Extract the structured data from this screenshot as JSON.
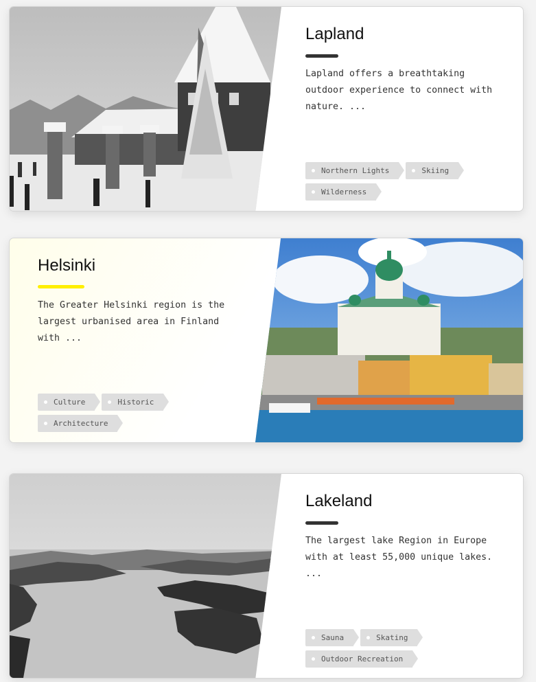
{
  "cards": [
    {
      "title": "Lapland",
      "description": "Lapland offers a breathtaking outdoor experience to connect with nature. ...",
      "tags": [
        "Northern Lights",
        "Skiing",
        "Wilderness"
      ],
      "image": "snowy-village-photo",
      "accent_color": "#333333"
    },
    {
      "title": "Helsinki",
      "description": "The Greater Helsinki region is the largest urbanised area in Finland with ...",
      "tags": [
        "Culture",
        "Historic",
        "Architecture"
      ],
      "image": "helsinki-cathedral-photo",
      "accent_color": "#ffef00"
    },
    {
      "title": "Lakeland",
      "description": "The largest lake Region in Europe with at least 55,000 unique lakes. ...",
      "tags": [
        "Sauna",
        "Skating",
        "Outdoor Recreation"
      ],
      "image": "lake-landscape-photo",
      "accent_color": "#333333"
    }
  ]
}
